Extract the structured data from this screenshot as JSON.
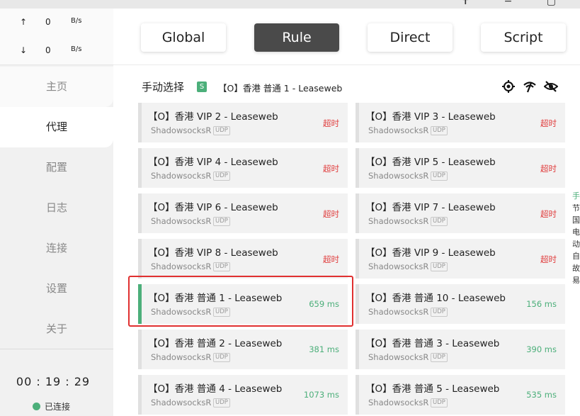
{
  "window": {
    "chrome_icons": "✝ − ▢"
  },
  "traffic": {
    "up_arrow": "↑",
    "up_value": "0",
    "up_unit": "B/s",
    "down_arrow": "↓",
    "down_value": "0",
    "down_unit": "B/s"
  },
  "nav": {
    "items": [
      {
        "label": "主页"
      },
      {
        "label": "代理"
      },
      {
        "label": "配置"
      },
      {
        "label": "日志"
      },
      {
        "label": "连接"
      },
      {
        "label": "设置"
      },
      {
        "label": "关于"
      }
    ],
    "active_index": 1
  },
  "footer": {
    "time": "00 : 19 : 29",
    "status": "已连接",
    "status_color": "#4caf7a"
  },
  "modes": [
    {
      "label": "Global"
    },
    {
      "label": "Rule"
    },
    {
      "label": "Direct"
    },
    {
      "label": "Script"
    }
  ],
  "active_mode": "Rule",
  "group": {
    "name": "手动选择",
    "badge": "S",
    "current": "【O】香港 普通 1 - Leaseweb",
    "icons": [
      "locate-icon",
      "wifi-test-icon",
      "hide-icon"
    ]
  },
  "proxies": [
    {
      "name": "【O】香港 VIP 2 - Leaseweb",
      "type": "ShadowsocksR",
      "udp": "UDP",
      "delay": "超时",
      "status": "timeout"
    },
    {
      "name": "【O】香港 VIP 3 - Leaseweb",
      "type": "ShadowsocksR",
      "udp": "UDP",
      "delay": "超时",
      "status": "timeout"
    },
    {
      "name": "【O】香港 VIP 4 - Leaseweb",
      "type": "ShadowsocksR",
      "udp": "UDP",
      "delay": "超时",
      "status": "timeout"
    },
    {
      "name": "【O】香港 VIP 5 - Leaseweb",
      "type": "ShadowsocksR",
      "udp": "UDP",
      "delay": "超时",
      "status": "timeout"
    },
    {
      "name": "【O】香港 VIP 6 - Leaseweb",
      "type": "ShadowsocksR",
      "udp": "UDP",
      "delay": "超时",
      "status": "timeout"
    },
    {
      "name": "【O】香港 VIP 7 - Leaseweb",
      "type": "ShadowsocksR",
      "udp": "UDP",
      "delay": "超时",
      "status": "timeout"
    },
    {
      "name": "【O】香港 VIP 8 - Leaseweb",
      "type": "ShadowsocksR",
      "udp": "UDP",
      "delay": "超时",
      "status": "timeout"
    },
    {
      "name": "【O】香港 VIP 9 - Leaseweb",
      "type": "ShadowsocksR",
      "udp": "UDP",
      "delay": "超时",
      "status": "timeout"
    },
    {
      "name": "【O】香港 普通 1 - Leaseweb",
      "type": "ShadowsocksR",
      "udp": "UDP",
      "delay": "659 ms",
      "status": "ok",
      "selected": true
    },
    {
      "name": "【O】香港 普通 10 - Leaseweb",
      "type": "ShadowsocksR",
      "udp": "UDP",
      "delay": "156 ms",
      "status": "ok"
    },
    {
      "name": "【O】香港 普通 2 - Leaseweb",
      "type": "ShadowsocksR",
      "udp": "UDP",
      "delay": "381 ms",
      "status": "ok"
    },
    {
      "name": "【O】香港 普通 3 - Leaseweb",
      "type": "ShadowsocksR",
      "udp": "UDP",
      "delay": "390 ms",
      "status": "ok"
    },
    {
      "name": "【O】香港 普通 4 - Leaseweb",
      "type": "ShadowsocksR",
      "udp": "UDP",
      "delay": "1073 ms",
      "status": "ok"
    },
    {
      "name": "【O】香港 普通 5 - Leaseweb",
      "type": "ShadowsocksR",
      "udp": "UDP",
      "delay": "535 ms",
      "status": "ok"
    }
  ],
  "edge_panel": {
    "chars": [
      "手",
      "节",
      "国",
      "电",
      "动",
      "自",
      "故",
      "易"
    ]
  },
  "colors": {
    "accent": "#4caf7a",
    "timeout": "#e04040",
    "active_mode_bg": "#4a4a4a",
    "highlight": "#e03030"
  }
}
